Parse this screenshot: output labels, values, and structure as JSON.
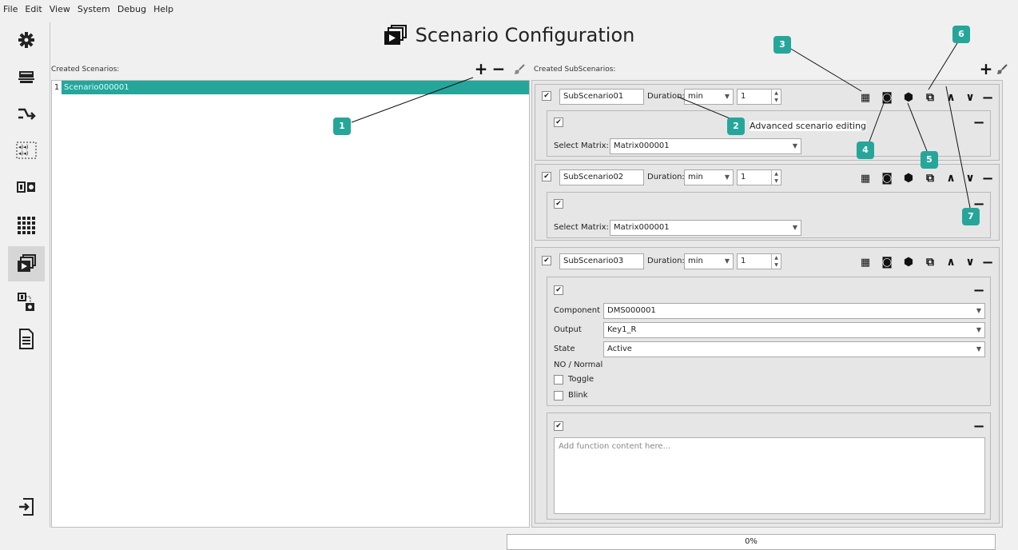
{
  "menu": [
    "File",
    "Edit",
    "View",
    "System",
    "Debug",
    "Help"
  ],
  "title": "Scenario Configuration",
  "left": {
    "label": "Created Scenarios:",
    "items": [
      {
        "num": "1",
        "name": "Scenario000001"
      }
    ]
  },
  "right": {
    "label": "Created SubScenarios:",
    "duration_label": "Duration:",
    "unit": "min",
    "select_matrix_label": "Select Matrix:",
    "subs": [
      {
        "name": "SubScenario01",
        "value": "1",
        "matrix": "Matrix000001"
      },
      {
        "name": "SubScenario02",
        "value": "1",
        "matrix": "Matrix000001"
      },
      {
        "name": "SubScenario03",
        "value": "1"
      }
    ],
    "sub3": {
      "component_label": "Component",
      "component": "DMS000001",
      "output_label": "Output",
      "output": "Key1_R",
      "state_label": "State",
      "state": "Active",
      "mode_label": "NO / Normal",
      "toggle_label": "Toggle",
      "blink_label": "Blink",
      "function_placeholder": "Add function content here..."
    }
  },
  "callouts": {
    "n1": "1",
    "n2": "2",
    "n3": "3",
    "n4": "4",
    "n5": "5",
    "n6": "6",
    "n7": "7",
    "advanced": "Advanced scenario editing"
  },
  "status": "0%",
  "accent": "#26a69a"
}
